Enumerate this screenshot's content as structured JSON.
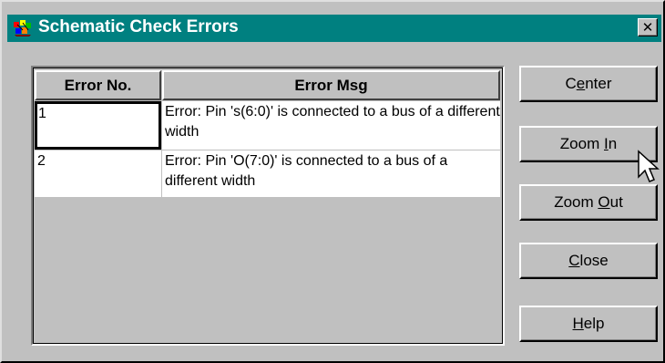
{
  "window": {
    "title": "Schematic Check Errors",
    "close_glyph": "✕",
    "titlebar_color": "#008080",
    "background_color": "#c0c0c0"
  },
  "grid": {
    "columns": [
      "Error No.",
      "Error Msg"
    ],
    "rows": [
      {
        "number": "1",
        "message": "Error: Pin 's(6:0)' is connected to a bus of a different width",
        "selected": true
      },
      {
        "number": "2",
        "message": "Error: Pin 'O(7:0)' is connected to a bus of a different width",
        "selected": false
      }
    ]
  },
  "buttons": {
    "center": {
      "pre": "C",
      "key": "e",
      "post": "nter"
    },
    "zoom_in": {
      "pre": "Zoom ",
      "key": "I",
      "post": "n"
    },
    "zoom_out": {
      "pre": "Zoom ",
      "key": "O",
      "post": "ut"
    },
    "close": {
      "pre": "",
      "key": "C",
      "post": "lose"
    },
    "help": {
      "pre": "",
      "key": "H",
      "post": "elp"
    }
  },
  "icons": {
    "app": "schematic-app-icon",
    "close": "close-icon",
    "cursor": "mouse-pointer-icon"
  }
}
